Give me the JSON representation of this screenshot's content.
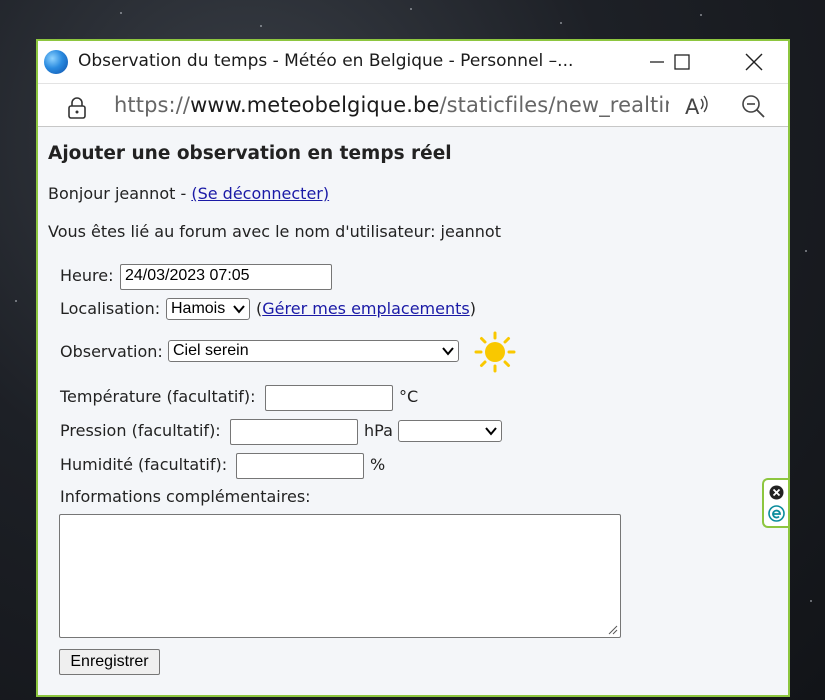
{
  "window": {
    "title": "Observation du temps - Météo en Belgique - Personnel –...",
    "url_prefix": "https://",
    "url_host": "www.meteobelgique.be",
    "url_path": "/staticfiles/new_realtime..."
  },
  "page": {
    "title": "Ajouter une observation en temps réel",
    "greeting": "Bonjour jeannot - ",
    "logout_link": "(Se déconnecter)",
    "forum_text": "Vous êtes lié au forum avec le nom d'utilisateur: jeannot"
  },
  "form": {
    "hour_label": "Heure:",
    "hour_value": "24/03/2023 07:05",
    "location_label": "Localisation:",
    "location_value": "Hamois",
    "manage_open": "(",
    "manage_link": "Gérer mes emplacements",
    "manage_close": ")",
    "observation_label": "Observation:",
    "observation_value": "Ciel serein",
    "temperature_label": "Température (facultatif):",
    "temperature_value": "",
    "temperature_unit": "°C",
    "pressure_label": "Pression (facultatif):",
    "pressure_value": "",
    "pressure_unit": "hPa",
    "pressure_select_value": "",
    "humidity_label": "Humidité (facultatif):",
    "humidity_value": "",
    "humidity_unit": "%",
    "info_label": "Informations complémentaires:",
    "info_value": "",
    "submit_label": "Enregistrer"
  },
  "colors": {
    "window_border": "#8dc63f",
    "link": "#1a1aa6",
    "sun": "#f9c800"
  },
  "icons": {
    "weather": "sun-icon",
    "side_tab_top": "close-circle-icon",
    "side_tab_bottom": "edge-e-icon"
  }
}
